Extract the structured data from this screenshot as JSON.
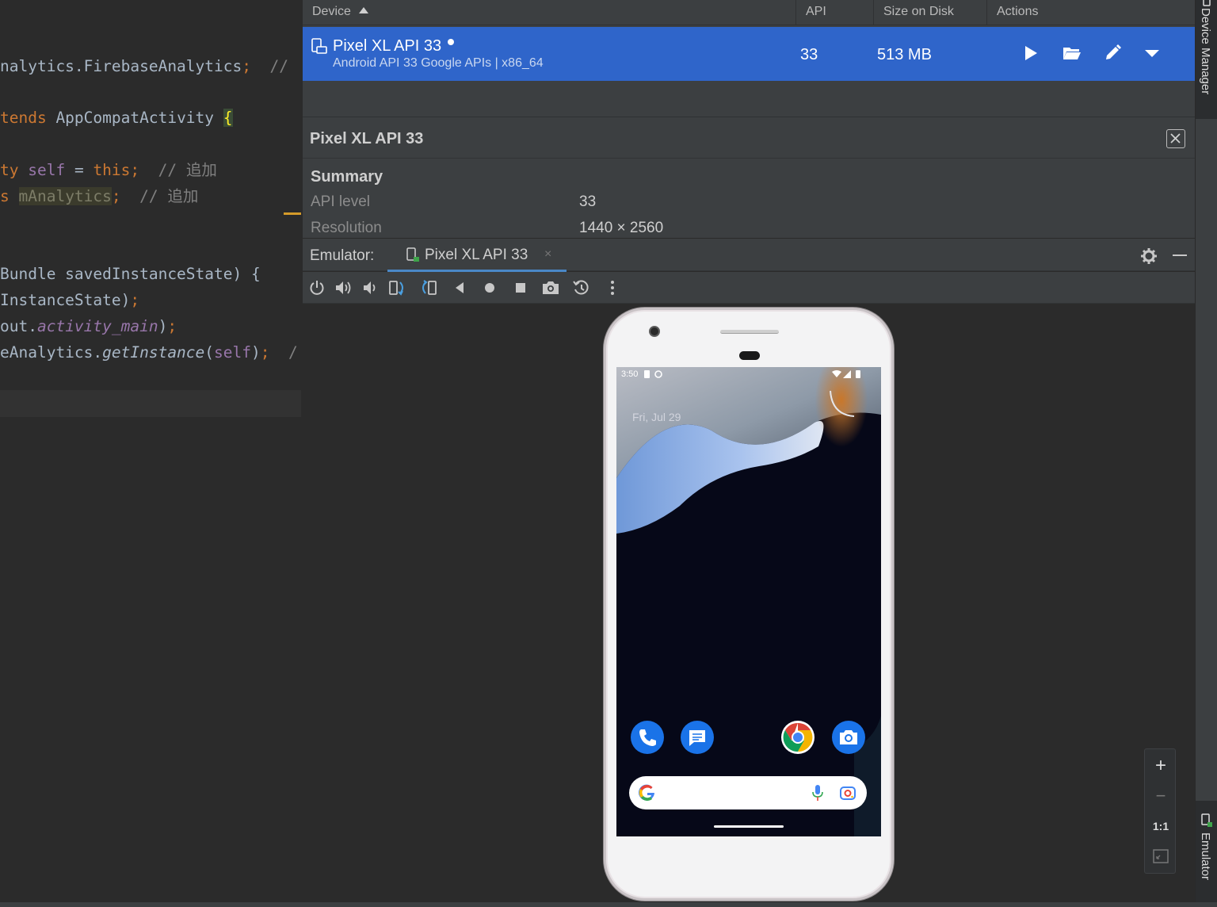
{
  "editor": {
    "lines": [
      {
        "code": "nalytics.FirebaseAnalytics",
        "semi": ";",
        "comment": "//"
      },
      {
        "kw": "tends",
        "rest": " AppCompatActivity ",
        "brace": "{"
      },
      {
        "kw": "ty",
        "self": "self",
        "eq": " = ",
        "this": "this",
        "semi": ";",
        "comment": "// 追加"
      },
      {
        "kw": "s",
        "field": "mAnalytics",
        "semi": ";",
        "comment": "// 追加"
      },
      {
        "code": "Bundle savedInstanceState) {"
      },
      {
        "code": "InstanceState)",
        "semi": ";"
      },
      {
        "code": "out.",
        "ital": "activity_main",
        "rest": ")",
        "semi": ";"
      },
      {
        "code": "eAnalytics.",
        "ital": "getInstance",
        "rest": "(",
        "self": "self",
        "rest2": ")",
        "semi": ";",
        "comment": "/"
      }
    ]
  },
  "device_manager": {
    "columns": {
      "device": "Device",
      "api": "API",
      "size": "Size on Disk",
      "actions": "Actions"
    },
    "row": {
      "name": "Pixel XL API 33",
      "subtitle": "Android API 33 Google APIs | x86_64",
      "api": "33",
      "size": "513 MB",
      "actions": [
        "play-icon",
        "folder-icon",
        "edit-icon",
        "dropdown-icon"
      ]
    },
    "details": {
      "title": "Pixel XL API 33",
      "summary_title": "Summary",
      "rows": [
        {
          "label": "API level",
          "value": "33"
        },
        {
          "label": "Resolution",
          "value": "1440 × 2560"
        }
      ]
    }
  },
  "emulator": {
    "label": "Emulator:",
    "tab": "Pixel XL API 33",
    "tab_close": "×",
    "toolbar_icons": [
      "power-icon",
      "volume-up-icon",
      "volume-down-icon",
      "rotate-left-icon",
      "rotate-right-icon",
      "back-icon",
      "home-icon",
      "overview-icon",
      "screenshot-icon",
      "snapshot-icon",
      "more-icon"
    ],
    "phone": {
      "status_time": "3:50",
      "lock_date": "Fri, Jul 29",
      "dock_apps": [
        "phone-app-icon",
        "messages-app-icon",
        "chrome-app-icon",
        "camera-app-icon"
      ]
    },
    "zoom": {
      "plus": "+",
      "minus": "−",
      "one_to_one": "1:1"
    }
  },
  "side_strip": {
    "device_manager": "Device Manager",
    "emulator": "Emulator"
  },
  "colors": {
    "selection": "#2f65ca",
    "accent": "#4a88c7",
    "panel": "#3c3f41",
    "editor_bg": "#2b2b2b"
  }
}
